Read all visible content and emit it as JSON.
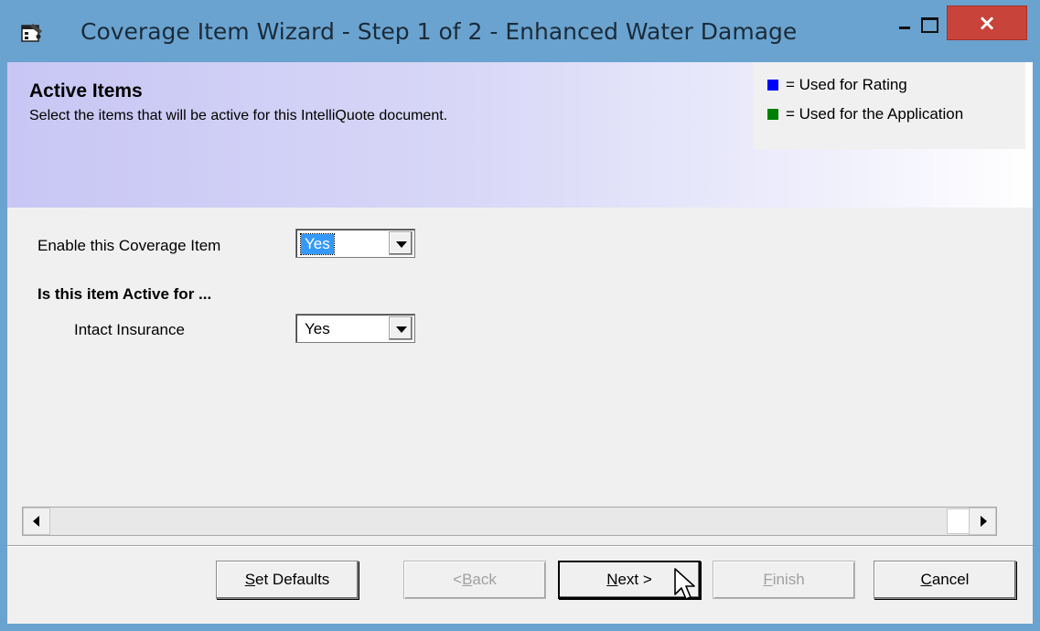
{
  "window": {
    "title": "Coverage Item Wizard - Step 1 of 2 - Enhanced Water Damage",
    "close_glyph": "×"
  },
  "header": {
    "title": "Active Items",
    "subtitle": "Select the items that will be active for this IntelliQuote document."
  },
  "legend": [
    {
      "label": "= Used for Rating",
      "color": "#0000ff"
    },
    {
      "label": "= Used for the Application",
      "color": "#008000"
    }
  ],
  "form": {
    "enable_label": "Enable this Coverage Item",
    "enable_value": "Yes",
    "active_heading": "Is this item Active for ...",
    "insurer_label": "Intact Insurance",
    "insurer_value": "Yes"
  },
  "buttons": {
    "set_defaults": {
      "pre": "",
      "mnemonic": "S",
      "post": "et Defaults"
    },
    "back": {
      "pre": "<",
      "mnemonic": "B",
      "post": "ack"
    },
    "next": {
      "pre": "",
      "mnemonic": "N",
      "post": "ext >"
    },
    "finish": {
      "pre": "",
      "mnemonic": "F",
      "post": "inish"
    },
    "cancel": {
      "pre": "",
      "mnemonic": "C",
      "post": "ancel"
    }
  }
}
